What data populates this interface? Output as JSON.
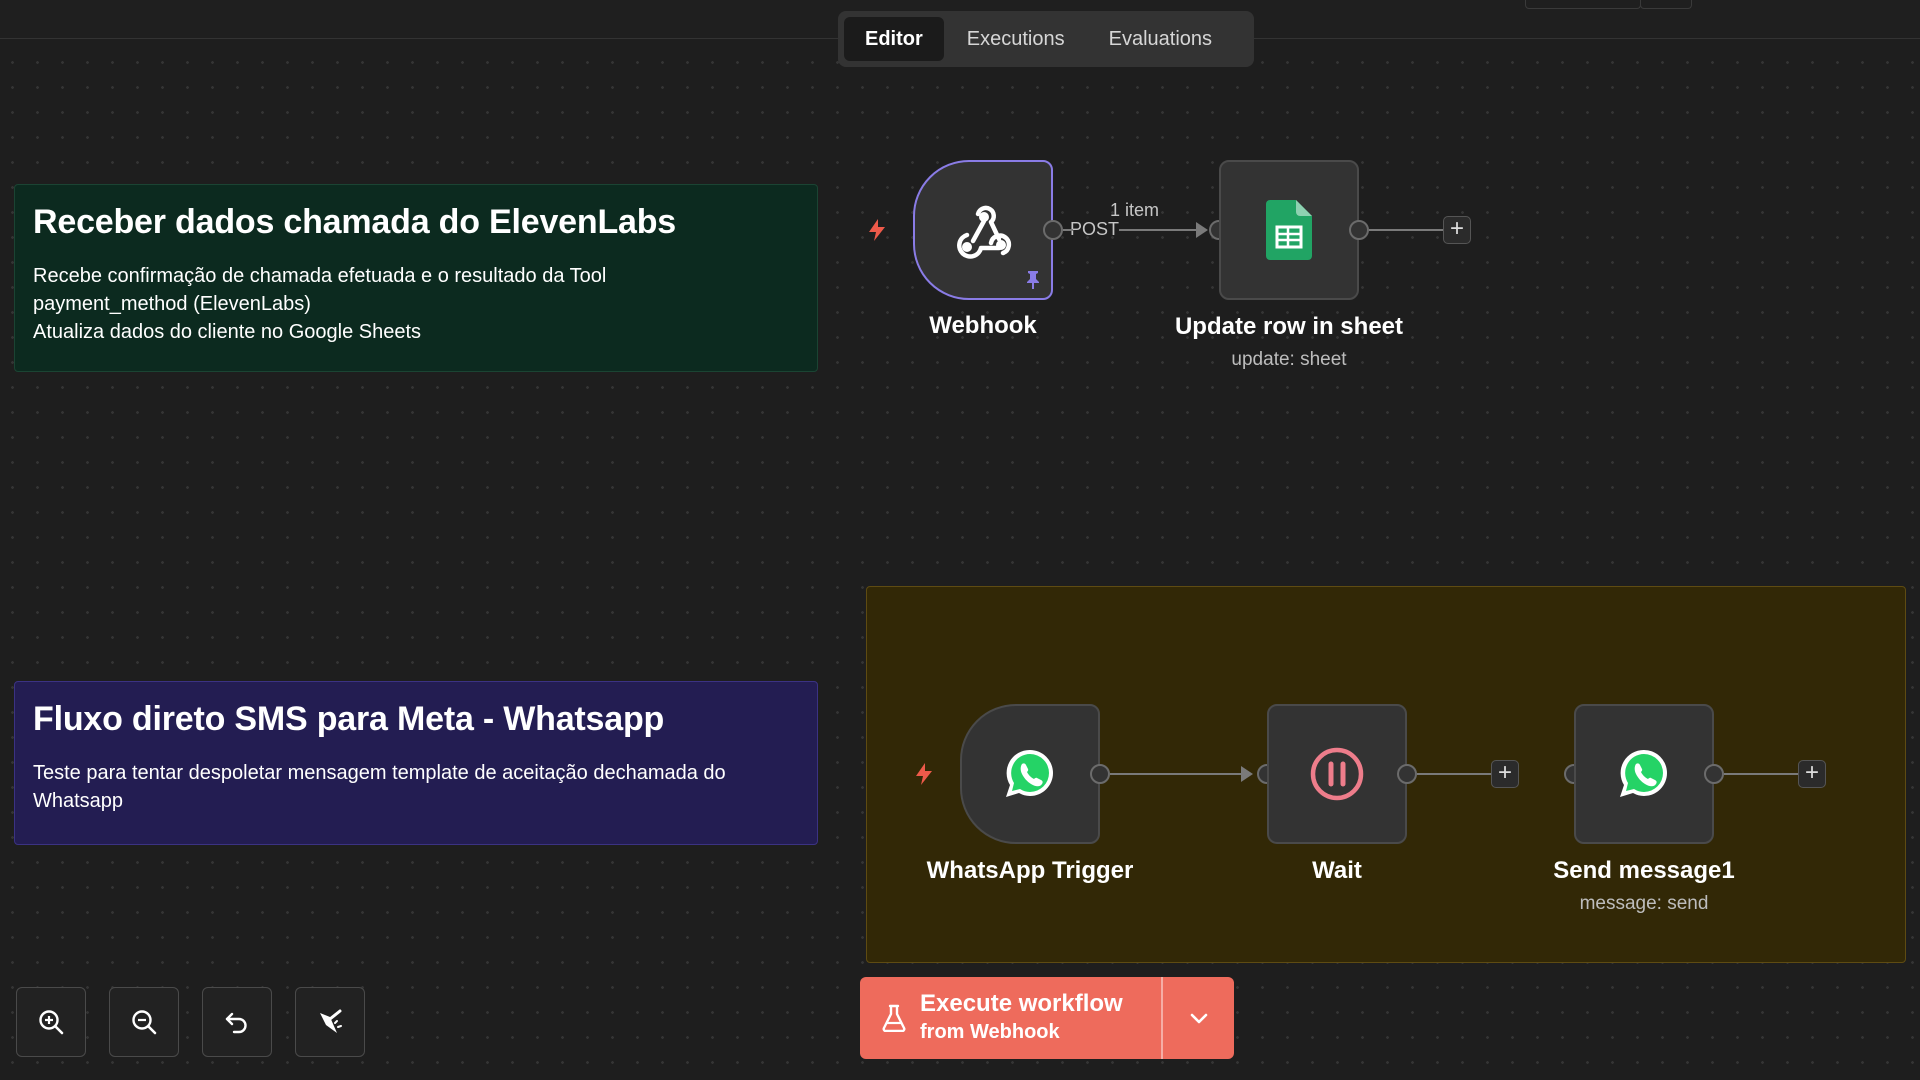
{
  "tabs": [
    {
      "label": "Editor",
      "active": true
    },
    {
      "label": "Executions",
      "active": false
    },
    {
      "label": "Evaluations",
      "active": false
    }
  ],
  "sticky_notes": [
    {
      "title": "Receber dados chamada do ElevenLabs",
      "lines": [
        "Recebe confirmação de chamada efetuada e o resultado da Tool",
        "payment_method (ElevenLabs)",
        "Atualiza dados do cliente no Google Sheets"
      ],
      "color": "#0c2a1f"
    },
    {
      "title": "Fluxo direto SMS para Meta - Whatsapp",
      "lines": [
        "Teste para tentar despoletar mensagem template de aceitação dechamada do",
        "Whatsapp"
      ],
      "color": "#231d52"
    },
    {
      "color": "#322806"
    }
  ],
  "nodes": {
    "webhook": {
      "name": "Webhook",
      "icon": "webhook-icon",
      "pinned": true
    },
    "update_row": {
      "name": "Update row in sheet",
      "subtitle": "update: sheet",
      "icon": "google-sheets-icon",
      "color": "#21a464"
    },
    "whatsapp_trigger": {
      "name": "WhatsApp Trigger",
      "icon": "whatsapp-icon",
      "color": "#25d366"
    },
    "wait": {
      "name": "Wait",
      "icon": "pause-circle-icon",
      "color": "#ee7d8b"
    },
    "send_message": {
      "name": "Send message1",
      "subtitle": "message: send",
      "icon": "whatsapp-icon",
      "color": "#25d366"
    }
  },
  "edges": {
    "webhook_output_label": "POST",
    "webhook_to_sheet_items": "1 item"
  },
  "canvas_controls": [
    {
      "name": "zoom-in",
      "icon": "zoom-in-icon"
    },
    {
      "name": "zoom-out",
      "icon": "zoom-out-icon"
    },
    {
      "name": "reset-zoom",
      "icon": "undo-icon"
    },
    {
      "name": "tidy-up",
      "icon": "broom-icon"
    }
  ],
  "execute": {
    "title": "Execute workflow",
    "subtitle": "from Webhook",
    "color": "#ee6b5c"
  },
  "colors": {
    "canvas": "#1e1e1e",
    "trigger_bolt": "#ee5a4a",
    "selection": "#8a7ce6"
  }
}
